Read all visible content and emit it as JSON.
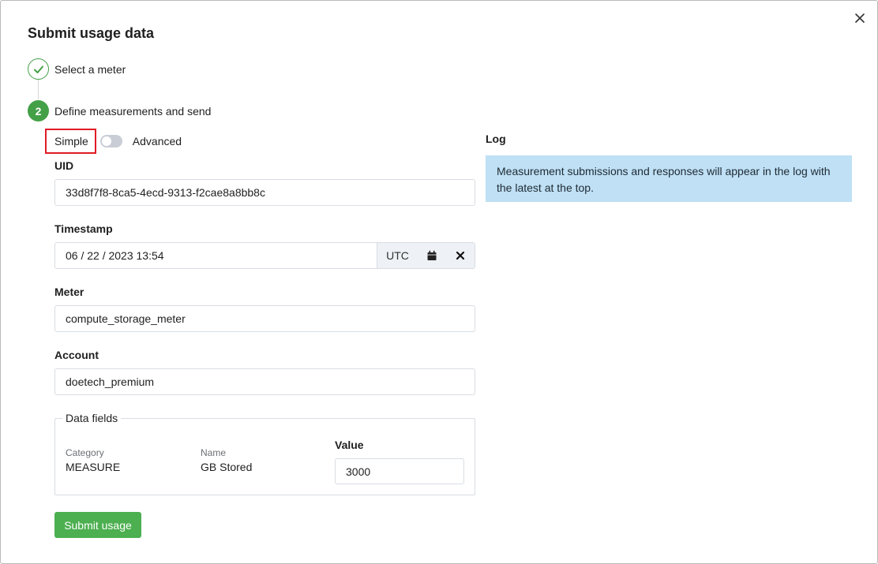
{
  "dialog": {
    "title": "Submit usage data",
    "close_label": "×"
  },
  "steps": [
    {
      "label": "Select a meter",
      "state": "done"
    },
    {
      "number": "2",
      "label": "Define measurements and send",
      "state": "active"
    }
  ],
  "mode": {
    "simple_label": "Simple",
    "advanced_label": "Advanced",
    "advanced_enabled": false
  },
  "form": {
    "uid": {
      "label": "UID",
      "value": "33d8f7f8-8ca5-4ecd-9313-f2cae8a8bb8c"
    },
    "timestamp": {
      "label": "Timestamp",
      "value": "06 / 22 / 2023 13:54",
      "tz": "UTC"
    },
    "meter": {
      "label": "Meter",
      "value": "compute_storage_meter"
    },
    "account": {
      "label": "Account",
      "value": "doetech_premium"
    }
  },
  "data_fields": {
    "legend": "Data fields",
    "category_label": "Category",
    "category_value": "MEASURE",
    "name_label": "Name",
    "name_value": "GB Stored",
    "value_label": "Value",
    "value": "3000"
  },
  "submit_label": "Submit usage",
  "log": {
    "title": "Log",
    "message": "Measurement submissions and responses will appear in the log with the latest at the top."
  },
  "colors": {
    "accent_green": "#43a047",
    "highlight_red": "#e01b24",
    "log_bg": "#bfe0f5"
  }
}
